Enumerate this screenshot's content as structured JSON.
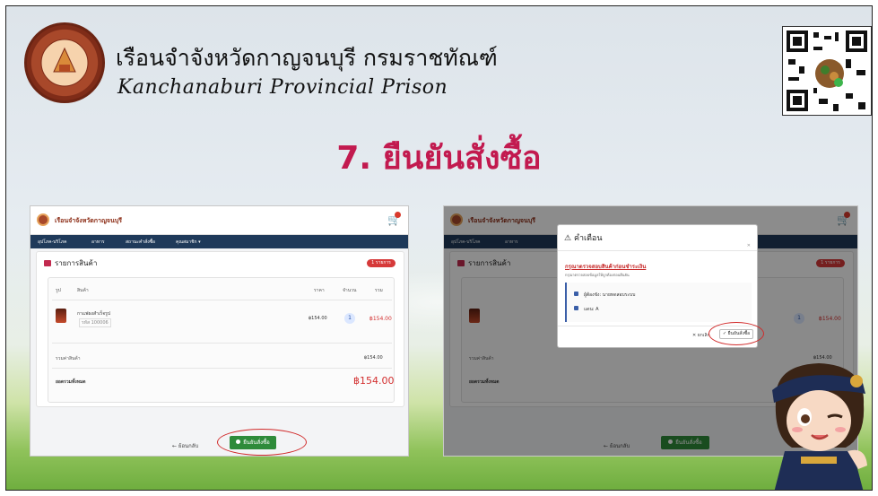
{
  "header": {
    "title_th": "เรือนจำจังหวัดกาญจนบุรี กรมราชทัณฑ์",
    "title_en": "Kanchanaburi Provincial Prison",
    "seal_text": "DEPARTMENT OF CORRECTIONS"
  },
  "step_title": "7. ยืนยันสั่งซื้อ",
  "left_screen": {
    "brand": "เรือนจำจังหวัดกาญจนบุรี",
    "cart_label": "ตะกร้า",
    "nav": [
      "อุปโภค-บริโภค",
      "อาหาร",
      "สถานะคำสั่งซื้อ",
      "คุณสมาชิก ▾"
    ],
    "card_title": "รายการสินค้า",
    "items_badge": "1 รายการ",
    "columns": [
      "รูป",
      "สินค้า",
      "ราคา",
      "จำนวน",
      "รวม"
    ],
    "product_name": "กาแฟผงสำเร็จรูป",
    "product_code": "รหัส 100006",
    "price": "฿154.00",
    "qty": "1",
    "line_total": "฿154.00",
    "subtotal_label": "รวมค่าสินค้า",
    "subtotal": "฿154.00",
    "grand_label": "ยอดรวมทั้งหมด",
    "grand_total": "฿154.00",
    "back_button": "← ย้อนกลับ",
    "confirm_button": "ยืนยันสั่งซื้อ"
  },
  "right_screen": {
    "brand": "เรือนจำจังหวัดกาญจนบุรี",
    "modal_title": "คำเตือน",
    "modal_warning": "กรุณาตรวจสอบสินค้าก่อนชำระเงิน",
    "modal_desc": "กรุณาตรวจสอบข้อมูลให้ถูกต้องก่อนยืนยัน",
    "recipient_label": "ผู้ต้องขัง: นายทดสอบระบบ",
    "zone_label": "แดน: A",
    "cancel_button": "✕ ยกเลิก",
    "ok_button": "✓ ยืนยันสั่งซื้อ",
    "subtotal": "฿154.00",
    "price": "฿154.00",
    "back_button": "← ย้อนกลับ",
    "confirm_button": "ยืนยันสั่งซื้อ"
  },
  "colors": {
    "step_title": "#c21a4f",
    "nav_bar": "#1f3a5a",
    "confirm_green": "#2e8b3a",
    "highlight_ring": "#d12b2b"
  }
}
